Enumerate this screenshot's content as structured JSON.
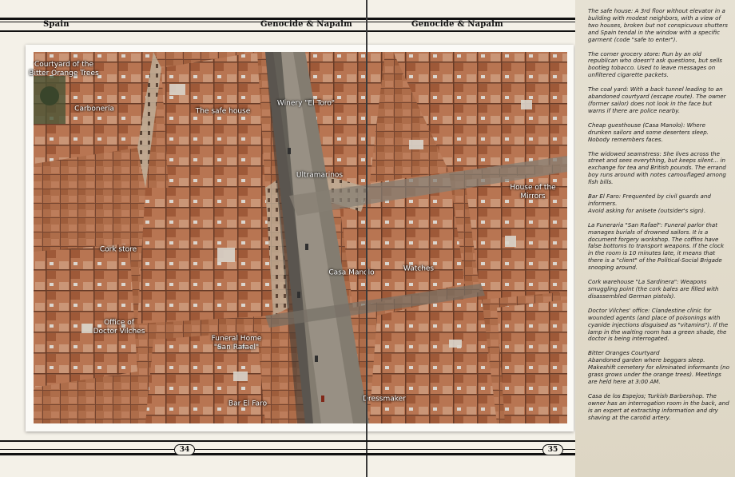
{
  "header": {
    "left_title": "Spain",
    "center_left_title": "Genocide & Napalm",
    "center_right_title": "Genocide & Napalm"
  },
  "pages": {
    "left": "34",
    "right": "35"
  },
  "map_labels": [
    {
      "id": "courtyard",
      "text": "Courtyard of the\nBitter Orange Trees"
    },
    {
      "id": "carboneria",
      "text": "Carbonería"
    },
    {
      "id": "safe_house",
      "text": "The safe house"
    },
    {
      "id": "winery",
      "text": "Winery \"El Toro\""
    },
    {
      "id": "ultramarinos",
      "text": "Ultramarinos"
    },
    {
      "id": "house_mirrors",
      "text": "House of the\nMirrors"
    },
    {
      "id": "cork_store",
      "text": "Cork store"
    },
    {
      "id": "casa_manolo",
      "text": "Casa Manolo"
    },
    {
      "id": "watches",
      "text": "Watches"
    },
    {
      "id": "office_vilches",
      "text": "Office of\nDoctor Vilches"
    },
    {
      "id": "funeral_home",
      "text": "Funeral Home\n\"San Rafael\""
    },
    {
      "id": "bar_faro",
      "text": "Bar El Faro"
    },
    {
      "id": "dressmaker",
      "text": "Dressmaker"
    }
  ],
  "notes": [
    "The safe house: A 3rd floor without elevator in a building with modest neighbors, with a view of two houses, broken but not conspicuous shutters and Spain tendal in the window with a specific garment (code \"safe to enter\").",
    "The corner grocery store: Run by an old republican who doesn't ask questions, but sells bootleg tobacco. Used to leave messages on unfiltered cigarette packets.",
    "The coal yard: With a back tunnel leading to an abandoned courtyard (escape route). The owner (former sailor) does not look in the face but warns if there are police nearby.",
    "Cheap guesthouse (Casa Manolo): Where drunken sailors and some deserters sleep. Nobody remembers faces.",
    "The widowed seamstress: She lives across the street and sees everything, but keeps silent... in exchange for tea and British pounds. The errand boy runs around with notes camouflaged among fish bills.",
    "Bar El Faro: Frequented by civil guards and informers.\nAvoid asking for anisete (outsider's sign).",
    "La Funeraria \"San Rafael\": Funeral parlor that manages burials of drowned sailors. It is a document forgery workshop. The coffins have false bottoms to transport weapons. If the clock in the room is 10 minutes late, it means that there is a \"client\" of the Political-Social Brigade snooping around.",
    "Cork warehouse \"La Sardinera\": Weapons smuggling point (the cork bales are filled with disassembled German pistols).",
    "Doctor Vilches' office: Clandestine clinic for wounded agents (and place of poisonings with cyanide injections disguised as \"vitamins\"). If the lamp in the waiting room has a green shade, the doctor is being interrogated.",
    "Bitter Oranges Courtyard\nAbandoned garden where beggars sleep. Makeshift cemetery for eliminated informants (no grass grows under the orange trees). Meetings are held here at 3:00 AM.",
    "Casa de los Espejos; Turkish Barbershop. The owner has an interrogation room in the back, and is an expert at extracting information and dry shaving at the carotid artery."
  ]
}
